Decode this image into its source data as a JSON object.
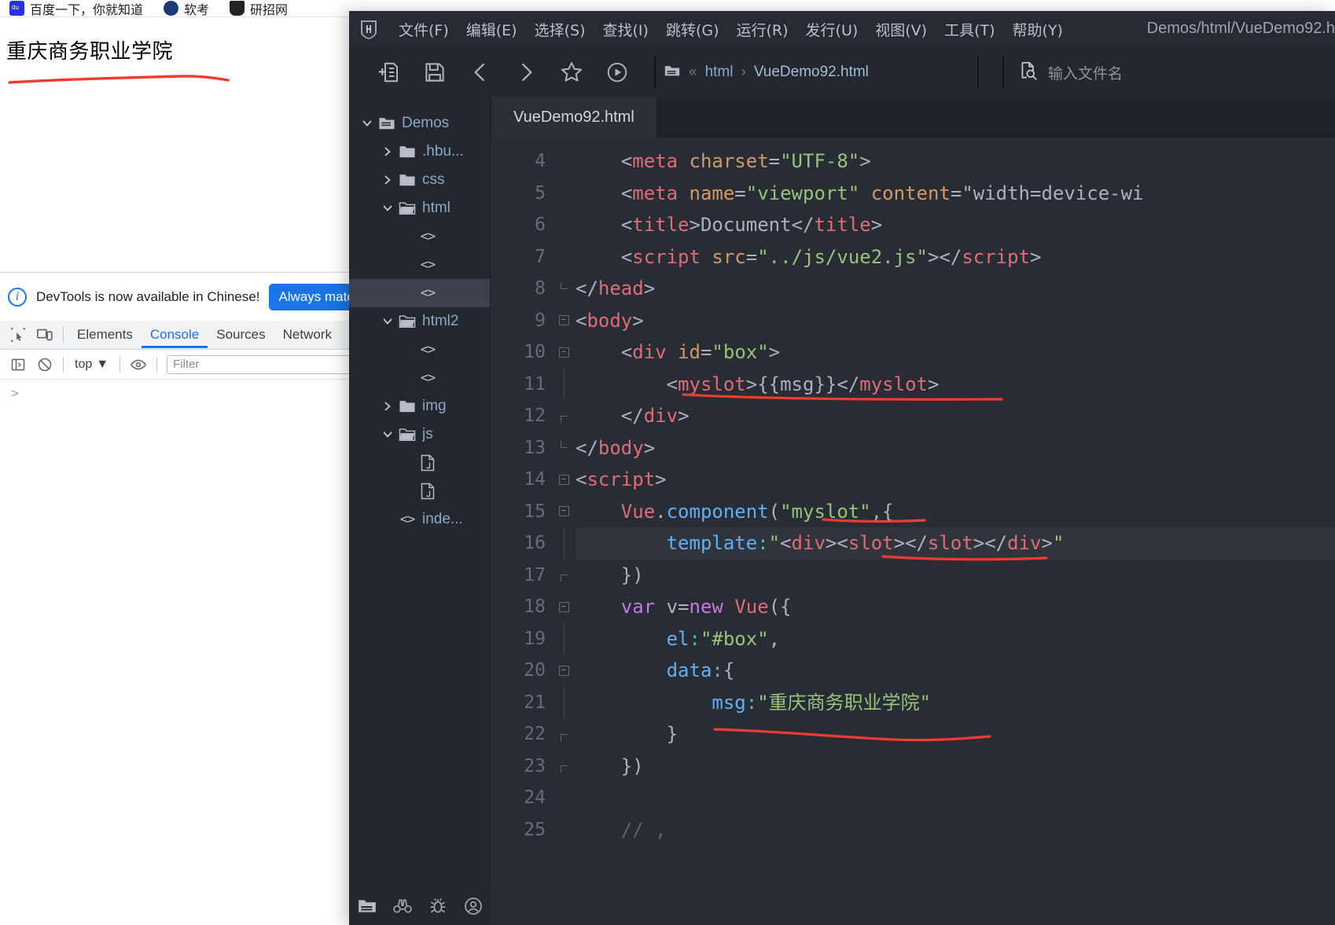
{
  "browser": {
    "bookmarks": [
      {
        "label": "百度一下，你就知道",
        "icon": "baidu-icon"
      },
      {
        "label": "软考",
        "icon": "ruankao-icon"
      },
      {
        "label": "研招网",
        "icon": "yanzhao-icon"
      }
    ],
    "page_heading": "重庆商务职业学院",
    "devtools": {
      "banner_text": "DevTools is now available in Chinese!",
      "banner_button": "Always match Chrome's language",
      "info_icon": "info-icon",
      "tabs": [
        {
          "label": "Elements",
          "active": false
        },
        {
          "label": "Console",
          "active": true
        },
        {
          "label": "Sources",
          "active": false
        },
        {
          "label": "Network",
          "active": false
        }
      ],
      "inspect_icon": "inspect-element-icon",
      "device_icon": "device-toolbar-icon",
      "sidebar_icon": "console-sidebar-icon",
      "clear_icon": "clear-console-icon",
      "context": "top",
      "context_caret": "chevron-down-icon",
      "eye_icon": "live-expression-icon",
      "filter_placeholder": "Filter",
      "prompt": ">"
    }
  },
  "hbuilderx": {
    "logo": "hbuilderx-logo-icon",
    "menus": [
      "文件(F)",
      "编辑(E)",
      "选择(S)",
      "查找(I)",
      "跳转(G)",
      "运行(R)",
      "发行(U)",
      "视图(V)",
      "工具(T)",
      "帮助(Y)"
    ],
    "window_title": "Demos/html/VueDemo92.h",
    "toolbar": [
      {
        "name": "new-file-icon"
      },
      {
        "name": "save-icon"
      },
      {
        "name": "back-icon"
      },
      {
        "name": "forward-icon"
      },
      {
        "name": "favorite-star-icon"
      },
      {
        "name": "run-preview-icon"
      }
    ],
    "breadcrumb": {
      "folder_icon": "folder-icon",
      "collapse_icon": "double-chevron-left-icon",
      "folder": "html",
      "separator": "chevron-right-icon",
      "file": "VueDemo92.html"
    },
    "file_search": {
      "icon": "file-search-icon",
      "placeholder": "输入文件名"
    },
    "sidebar": {
      "tree": [
        {
          "label": "Demos",
          "indent": 0,
          "twisty": "chevron-down-icon",
          "icon": "folder-open-root-icon",
          "selected": false
        },
        {
          "label": ".hbu...",
          "indent": 1,
          "twisty": "chevron-right-icon",
          "icon": "folder-icon",
          "selected": false
        },
        {
          "label": "css",
          "indent": 1,
          "twisty": "chevron-right-icon",
          "icon": "folder-icon",
          "selected": false
        },
        {
          "label": "html",
          "indent": 1,
          "twisty": "chevron-down-icon",
          "icon": "folder-open-icon",
          "selected": false
        },
        {
          "label": "",
          "indent": 2,
          "twisty": "",
          "icon": "html-file-icon",
          "selected": false
        },
        {
          "label": "",
          "indent": 2,
          "twisty": "",
          "icon": "html-file-icon",
          "selected": false
        },
        {
          "label": "",
          "indent": 2,
          "twisty": "",
          "icon": "html-file-icon",
          "selected": true
        },
        {
          "label": "html2",
          "indent": 1,
          "twisty": "chevron-down-icon",
          "icon": "folder-open-icon",
          "selected": false
        },
        {
          "label": "",
          "indent": 2,
          "twisty": "",
          "icon": "html-file-icon",
          "selected": false
        },
        {
          "label": "",
          "indent": 2,
          "twisty": "",
          "icon": "html-file-icon",
          "selected": false
        },
        {
          "label": "img",
          "indent": 1,
          "twisty": "chevron-right-icon",
          "icon": "folder-icon",
          "selected": false
        },
        {
          "label": "js",
          "indent": 1,
          "twisty": "chevron-down-icon",
          "icon": "folder-open-icon",
          "selected": false
        },
        {
          "label": "",
          "indent": 2,
          "twisty": "",
          "icon": "js-file-icon",
          "selected": false
        },
        {
          "label": "",
          "indent": 2,
          "twisty": "",
          "icon": "js-file-icon",
          "selected": false
        },
        {
          "label": "inde...",
          "indent": 1,
          "twisty": "",
          "icon": "html-file-icon",
          "selected": false
        }
      ],
      "status_icons": [
        {
          "name": "project-manager-icon",
          "active": true
        },
        {
          "name": "search-binoculars-icon",
          "active": false
        },
        {
          "name": "debug-bug-icon",
          "active": false
        },
        {
          "name": "account-circle-icon",
          "active": false
        }
      ]
    },
    "editor": {
      "tab": "VueDemo92.html",
      "first_line_number": 4,
      "lines": [
        {
          "n": 4,
          "fold": "",
          "indent": 0,
          "text": "    <meta charset=\"UTF-8\">"
        },
        {
          "n": 5,
          "fold": "",
          "indent": 0,
          "text": "    <meta name=\"viewport\" content=\"width=device-wi"
        },
        {
          "n": 6,
          "fold": "",
          "indent": 0,
          "text": "    <title>Document</title>"
        },
        {
          "n": 7,
          "fold": "",
          "indent": 0,
          "text": "    <script src=\"../js/vue2.js\"></script>"
        },
        {
          "n": 8,
          "fold": "end",
          "indent": 0,
          "text": "</head>"
        },
        {
          "n": 9,
          "fold": "box",
          "indent": 0,
          "text": "<body>"
        },
        {
          "n": 10,
          "fold": "box",
          "indent": 0,
          "text": "    <div id=\"box\">"
        },
        {
          "n": 11,
          "fold": "bar",
          "indent": 0,
          "text": "        <myslot>{{msg}}</myslot>"
        },
        {
          "n": 12,
          "fold": "mid",
          "indent": 0,
          "text": "    </div>"
        },
        {
          "n": 13,
          "fold": "end",
          "indent": 0,
          "text": "</body>"
        },
        {
          "n": 14,
          "fold": "box",
          "indent": 0,
          "text": "<script>"
        },
        {
          "n": 15,
          "fold": "box",
          "indent": 0,
          "text": "    Vue.component(\"myslot\",{"
        },
        {
          "n": 16,
          "fold": "bar",
          "indent": 0,
          "text": "        template:\"<div><slot></slot></div>\""
        },
        {
          "n": 17,
          "fold": "mid",
          "indent": 0,
          "text": "    })"
        },
        {
          "n": 18,
          "fold": "box",
          "indent": 0,
          "text": "    var v=new Vue({"
        },
        {
          "n": 19,
          "fold": "bar",
          "indent": 0,
          "text": "        el:\"#box\","
        },
        {
          "n": 20,
          "fold": "box",
          "indent": 0,
          "text": "        data:{"
        },
        {
          "n": 21,
          "fold": "bar",
          "indent": 0,
          "text": "            msg:\"重庆商务职业学院\""
        },
        {
          "n": 22,
          "fold": "mid",
          "indent": 0,
          "text": "        }"
        },
        {
          "n": 23,
          "fold": "mid",
          "indent": 0,
          "text": "    })"
        },
        {
          "n": 24,
          "fold": "",
          "indent": 0,
          "text": ""
        },
        {
          "n": 25,
          "fold": "",
          "indent": 0,
          "text": "    // ,"
        }
      ]
    }
  },
  "annotations": {
    "color": "#f03c2e",
    "marks": [
      "underline-browser-heading",
      "underline-myslot-tag",
      "underline-myslot-component-name",
      "underline-slot-template",
      "underline-msg-value"
    ]
  }
}
